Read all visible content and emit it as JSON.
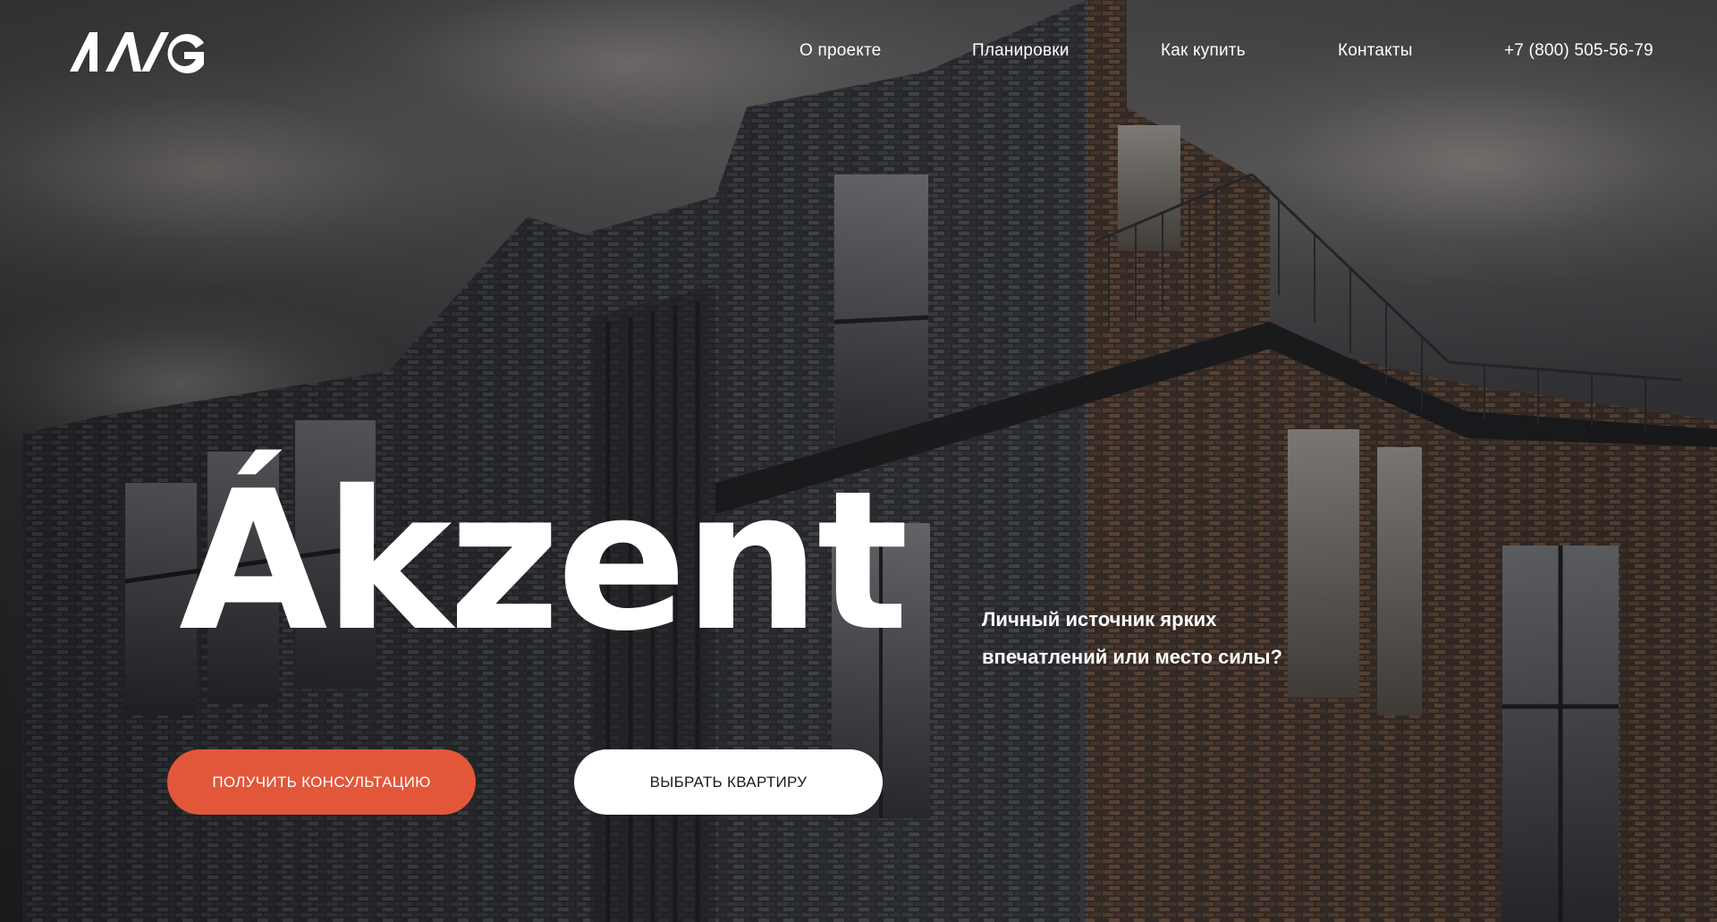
{
  "header": {
    "logo_alt": "AAG",
    "nav": {
      "about": "О проекте",
      "plans": "Планировки",
      "buy": "Как купить",
      "contacts": "Контакты"
    },
    "phone": "+7 (800) 505-56-79"
  },
  "hero": {
    "title": "Ákzent",
    "tagline_line1": "Личный источник ярких",
    "tagline_line2": "впечатлений или место силы?",
    "consult_button": "Получить консультацию",
    "choose_button": "Выбрать квартиру"
  },
  "colors": {
    "accent": "#e2573a",
    "text": "#ffffff",
    "button_light": "#ffffff"
  }
}
